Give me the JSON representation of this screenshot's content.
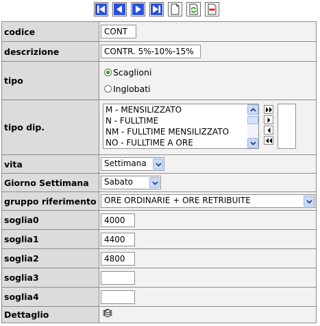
{
  "toolbar": {
    "buttons": [
      {
        "name": "first-record-icon"
      },
      {
        "name": "previous-record-icon"
      },
      {
        "name": "next-record-icon"
      },
      {
        "name": "last-record-icon"
      },
      {
        "name": "new-document-icon"
      },
      {
        "name": "refresh-icon"
      },
      {
        "name": "delete-icon"
      }
    ]
  },
  "fields": {
    "codice": {
      "label": "codice",
      "value": "CONT"
    },
    "descrizione": {
      "label": "descrizione",
      "value": "CONTR. 5%-10%-15%"
    },
    "tipo": {
      "label": "tipo",
      "options": [
        "Scaglioni",
        "Inglobati"
      ],
      "selected": "Scaglioni"
    },
    "tipo_dip": {
      "label": "tipo dip.",
      "available": [
        "M - MENSILIZZATO",
        "N - FULLTIME",
        "NM - FULLTIME MENSILIZZATO",
        "NO - FULLTIME A ORE"
      ],
      "selected_items": []
    },
    "vita": {
      "label": "vita",
      "value": "Settimana"
    },
    "giorno_settimana": {
      "label": "Giorno Settimana",
      "value": "Sabato"
    },
    "gruppo_riferimento": {
      "label": "gruppo riferimento",
      "value": "ORE ORDINARIE + ORE RETRIBUITE"
    },
    "soglia0": {
      "label": "soglia0",
      "value": "4000"
    },
    "soglia1": {
      "label": "soglia1",
      "value": "4400"
    },
    "soglia2": {
      "label": "soglia2",
      "value": "4800"
    },
    "soglia3": {
      "label": "soglia3",
      "value": ""
    },
    "soglia4": {
      "label": "soglia4",
      "value": ""
    },
    "dettaglio": {
      "label": "Dettaglio",
      "icon": "stack-detail-icon"
    }
  },
  "colors": {
    "label_bg": "#dcdcdc",
    "value_bg": "#f2f2f2",
    "nav_blue": "#1d44d8",
    "scroll_blue": "#c9d9f8"
  }
}
